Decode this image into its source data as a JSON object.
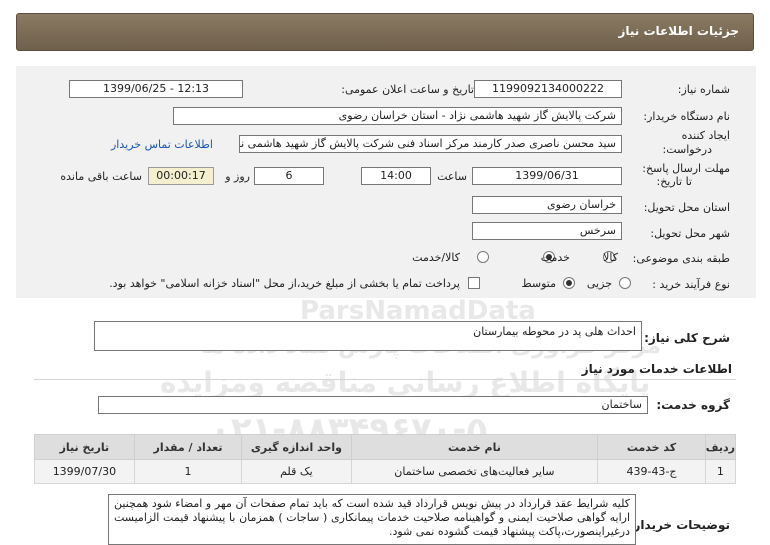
{
  "page": {
    "title": "جزئیات اطلاعات نیاز"
  },
  "form": {
    "need_number_label": "شماره نیاز:",
    "need_number": "1199092134000222",
    "announce_label": "تاریخ و ساعت اعلان عمومی:",
    "announce_value": "1399/06/25 - 12:13",
    "buyer_label": "نام دستگاه خریدار:",
    "buyer_value": "شرکت پالایش گاز شهید هاشمی نژاد - استان خراسان رضوی",
    "creator_label_1": "ایجاد کننده",
    "creator_label_2": "درخواست:",
    "creator_value": "سید محسن  ناصری صدر کارمند مرکز اسناد فنی شرکت پالایش گاز شهید هاشمی نژاد",
    "contact_link": "اطلاعات تماس خریدار",
    "deadline_label_1": "مهلت ارسال پاسخ:",
    "deadline_label_2": "تا تاریخ:",
    "deadline_date": "1399/06/31",
    "time_label": "ساعت",
    "deadline_time": "14:00",
    "days_value": "6",
    "days_label": "روز و",
    "remaining_time": "00:00:17",
    "remaining_label": "ساعت باقی مانده",
    "province_label": "استان محل تحویل:",
    "province_value": "خراسان رضوی",
    "city_label": "شهر محل تحویل:",
    "city_value": "سرخس",
    "category_label": "طبقه بندی موضوعی:",
    "category_options": [
      "کالا",
      "خدمت",
      "کالا/خدمت"
    ],
    "category_selected": "خدمت",
    "process_label": "نوع فرآیند خرید :",
    "process_options": [
      "جزیی",
      "متوسط"
    ],
    "process_selected": "متوسط",
    "payment_note": "پرداخت تمام یا بخشی از مبلغ خرید،از محل \"اسناد خزانه اسلامی\" خواهد بود."
  },
  "summary": {
    "label": "شرح کلی نیاز:",
    "value": "احداث هلی پد در محوطه بیمارستان"
  },
  "services_section": {
    "title": "اطلاعات خدمات مورد نیاز"
  },
  "service_group": {
    "label": "گروه خدمت:",
    "value": "ساختمان"
  },
  "table": {
    "headers": [
      "ردیف",
      "کد خدمت",
      "نام خدمت",
      "واحد اندازه گیری",
      "تعداد / مقدار",
      "تاریخ نیاز"
    ],
    "rows": [
      [
        "1",
        "ج-43-439",
        "سایر فعالیت‌های تخصصی ساختمان",
        "یک قلم",
        "1",
        "1399/07/30"
      ]
    ]
  },
  "buyer_notes": {
    "label": "توضیحات خریدار:",
    "value": "کلیه شرایط عقد قرارداد در پیش نویس قرارداد قید شده است که باید تمام صفحات آن مهر و امضاء شود همچنین ارایه گواهی صلاحیت ایمنی و گواهینامه صلاحیت خدمات پیمانکاری ( ساجات ) همزمان با پیشنهاد قیمت الزامیست درغیراینصورت،پاکت پیشنهاد قیمت گشوده نمی شود."
  },
  "watermark": {
    "brand": "ParsNamadData",
    "line1": "مرکز فراوری اطلاعات پارس نماد داده ها",
    "line2": "پایگاه اطلاع رسانی مناقصه ومزایده",
    "phone": "۰۲۱-۸۸۳۴۹۶۷۰-۵"
  },
  "colors": {
    "titlebar": "#7e6f59",
    "panel": "#f1f1f1",
    "link": "#1a56b5",
    "timer_bg": "#f3efcf"
  }
}
